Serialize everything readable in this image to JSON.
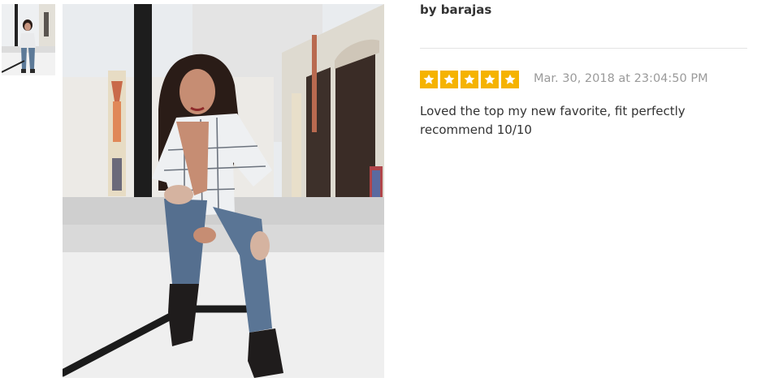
{
  "review": {
    "author": "by barajas",
    "rating": 5,
    "rating_max": 5,
    "date": "Mar. 30, 2018 at 23:04:50 PM",
    "text": "Loved the top my new favorite, fit perfectly recommend 10/10"
  },
  "colors": {
    "star_fill": "#f5b301",
    "text": "#333333",
    "muted": "#9a9a9a",
    "divider": "#e3e3e3"
  },
  "icons": {
    "star": "star-icon"
  }
}
